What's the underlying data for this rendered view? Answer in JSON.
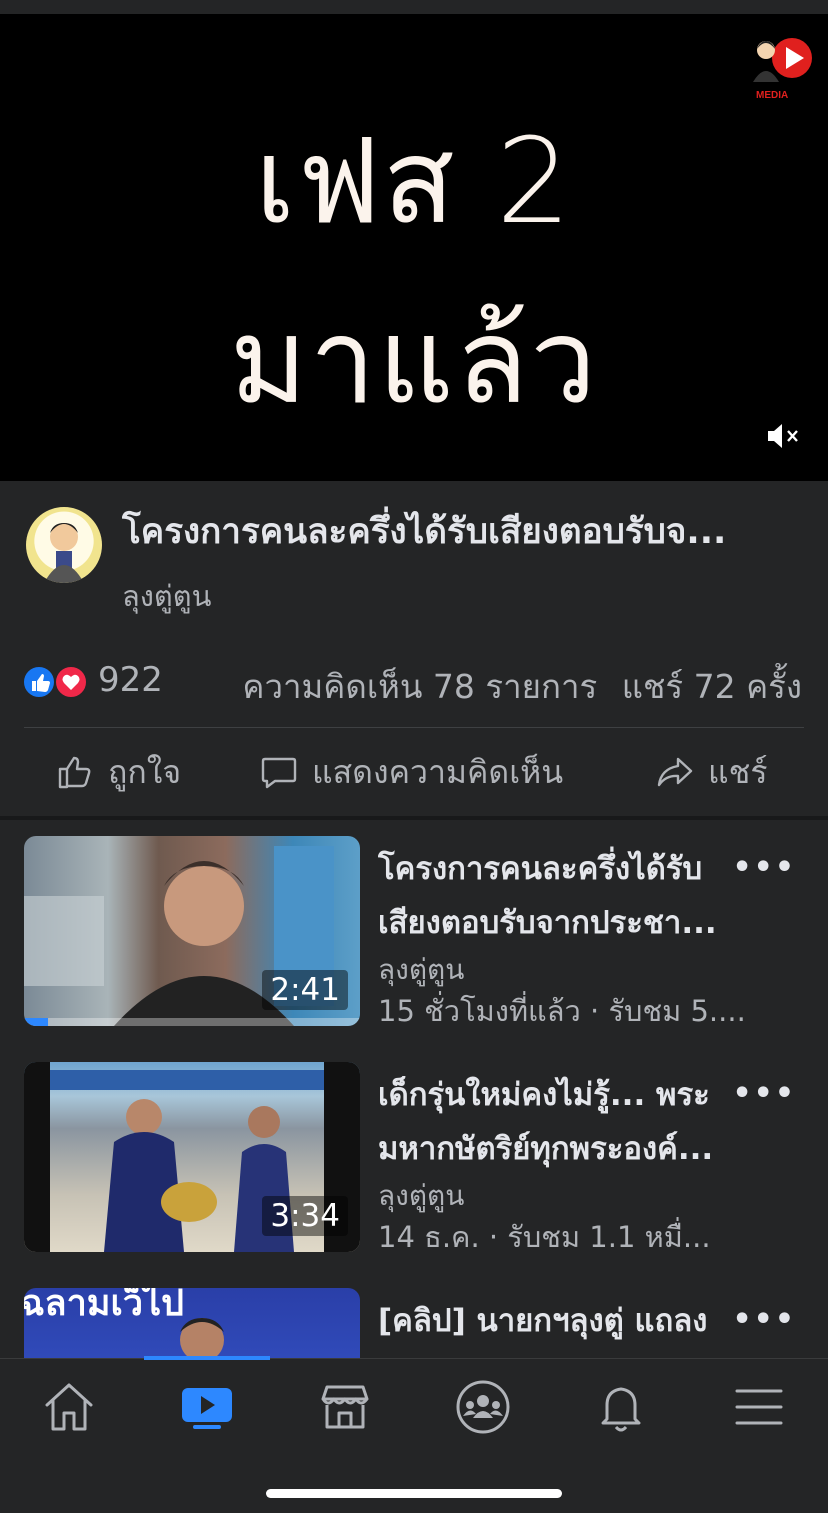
{
  "video": {
    "caption_line1": "เฟส 2",
    "caption_line2": "มาแล้ว",
    "logo_text": "MEDIA",
    "mute_icon": "speaker-muted-icon"
  },
  "post": {
    "title": "โครงการคนละครึ่งได้รับเสียงตอบรับจ...",
    "author": "ลุงตู่ตูน",
    "reaction_count": "922",
    "comments": "ความคิดเห็น 78 รายการ",
    "shares": "แชร์ 72 ครั้ง"
  },
  "actions": {
    "like": "ถูกใจ",
    "comment": "แสดงความคิดเห็น",
    "share": "แชร์"
  },
  "videos": [
    {
      "title_line1": "โครงการคนละครึ่งได้รับ",
      "title_line2": "เสียงตอบรับจากประชา...",
      "author": "ลุงตู่ตูน",
      "meta": "15 ชั่วโมงที่แล้ว · รับชม 5....",
      "duration": "2:41",
      "progress": 0.07
    },
    {
      "title_line1": "เด็กรุ่นใหม่คงไม่รู้... พระ",
      "title_line2": "มหากษัตริย์ทุกพระองค์...",
      "author": "ลุงตู่ตูน",
      "meta": "14 ธ.ค. · รับชม 1.1 หมื่...",
      "duration": "3:34"
    },
    {
      "title_line1": "[คลิป] นายกฯลุงตู่ แถลง",
      "thumb_text": "ฉลามเว็ไป"
    }
  ],
  "more_label": "•••",
  "nav": {
    "items": [
      "home-icon",
      "watch-icon",
      "marketplace-icon",
      "groups-icon",
      "notifications-icon",
      "menu-icon"
    ],
    "active": "watch-icon",
    "accent": "#2d88ff"
  }
}
